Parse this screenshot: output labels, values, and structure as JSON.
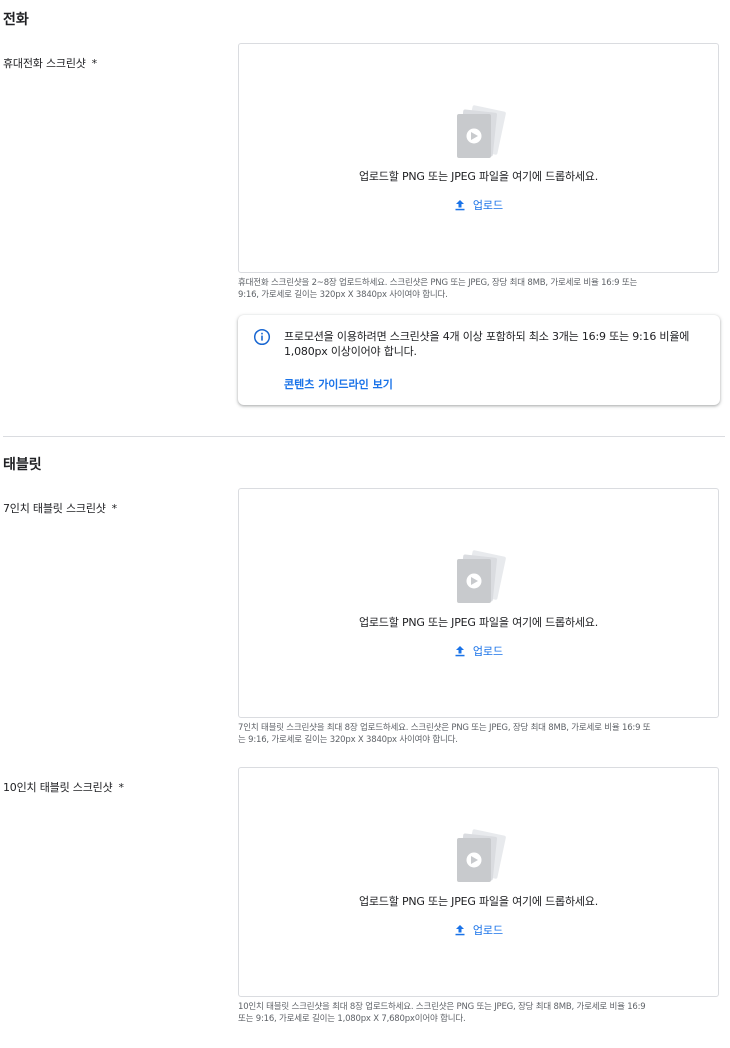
{
  "phone_section": {
    "title": "전화",
    "field_label": "휴대전화 스크린샷",
    "required_mark": "*",
    "drop_text": "업로드할 PNG 또는 JPEG 파일을 여기에 드롭하세요.",
    "upload_label": "업로드",
    "help_line1": "휴대전화 스크린샷을 2~8장 업로드하세요. 스크린샷은 PNG 또는 JPEG, 장당 최대 8MB, 가로세로 비율 16:9 또는",
    "help_line2": "9:16, 가로세로 길이는 320px X 3840px 사이여야 합니다.",
    "info_line1": "프로모션을 이용하려면 스크린샷을 4개 이상 포함하되 최소 3개는 16:9 또는 9:16 비율에",
    "info_line2": "1,080px 이상이어야 합니다.",
    "info_link": "콘텐츠 가이드라인 보기"
  },
  "tablet_section": {
    "title": "태블릿",
    "tablet7": {
      "field_label": "7인치 태블릿 스크린샷",
      "required_mark": "*",
      "drop_text": "업로드할 PNG 또는 JPEG 파일을 여기에 드롭하세요.",
      "upload_label": "업로드",
      "help_line1": "7인치 태블릿 스크린샷을 최대 8장 업로드하세요. 스크린샷은 PNG 또는 JPEG, 장당 최대 8MB, 가로세로 비율 16:9 또",
      "help_line2": "는 9:16, 가로세로 길이는 320px X 3840px 사이여야 합니다."
    },
    "tablet10": {
      "field_label": "10인치 태블릿 스크린샷",
      "required_mark": "*",
      "drop_text": "업로드할 PNG 또는 JPEG 파일을 여기에 드롭하세요.",
      "upload_label": "업로드",
      "help_line1": "10인치 태블릿 스크린샷을 최대 8장 업로드하세요. 스크린샷은 PNG 또는 JPEG, 장당 최대 8MB, 가로세로 비율 16:9",
      "help_line2": "또는 9:16, 가로세로 길이는 1,080px X 7,680px이어야 합니다."
    }
  },
  "icons": {
    "placeholder": "image-placeholder-icon",
    "upload": "upload-icon",
    "info": "info-icon"
  },
  "colors": {
    "accent": "#1a73e8",
    "info_icon": "#1967d2",
    "border": "#dadce0",
    "muted_text": "#5f6368"
  }
}
